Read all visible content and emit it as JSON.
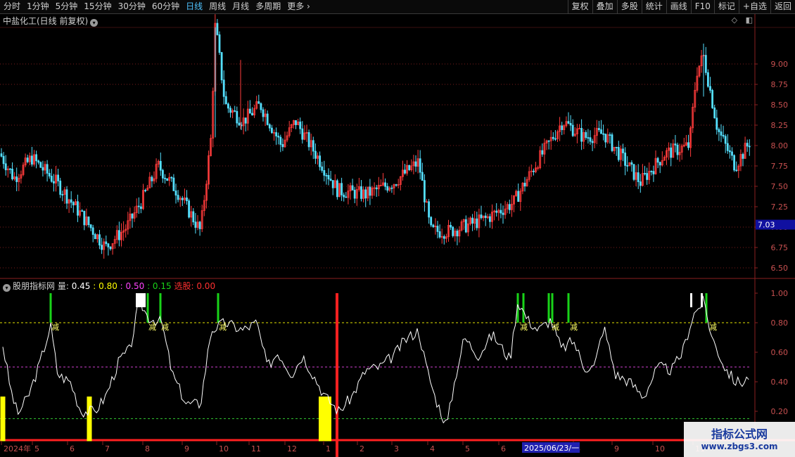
{
  "toolbar": {
    "periods": [
      "分时",
      "1分钟",
      "5分钟",
      "15分钟",
      "30分钟",
      "60分钟",
      "日线",
      "周线",
      "月线",
      "多周期",
      "更多"
    ],
    "active_period": "日线",
    "right_buttons": [
      "复权",
      "叠加",
      "多股",
      "统计",
      "画线",
      "F10",
      "标记",
      "+自选",
      "返回"
    ]
  },
  "stock": {
    "title": "中盐化工(日线 前复权)"
  },
  "indicator": {
    "name": "股朋指标网",
    "label": "量:",
    "v1": "0.45",
    "v2": ": 0.80",
    "v3": ": 0.50",
    "v4": ": 0.15",
    "sel_label": "选股:",
    "sel_value": "0.00"
  },
  "price_axis": {
    "labels": [
      "9.00",
      "8.75",
      "8.50",
      "8.25",
      "8.00",
      "7.75",
      "7.50",
      "7.25",
      "7.00",
      "6.75",
      "6.50"
    ],
    "current": "7.03"
  },
  "ind_axis": {
    "labels": [
      "1.00",
      "0.80",
      "0.60",
      "0.40",
      "0.20"
    ]
  },
  "date_axis": {
    "labels": [
      "2024年",
      "5",
      "6",
      "7",
      "8",
      "9",
      "10",
      "11",
      "12",
      "1",
      "2",
      "3",
      "4",
      "5",
      "6",
      "7",
      "8",
      "9",
      "10",
      "11"
    ],
    "highlight": "2025/06/23/一"
  },
  "signal_text": "减",
  "watermark": {
    "cn": "指标公式网",
    "url": "www.zbgs3.com"
  },
  "colors": {
    "up": "#ff3b3b",
    "down": "#54e0ff",
    "grid": "#7a1c1c",
    "green": "#19d319",
    "yellow": "#ffff00"
  }
}
